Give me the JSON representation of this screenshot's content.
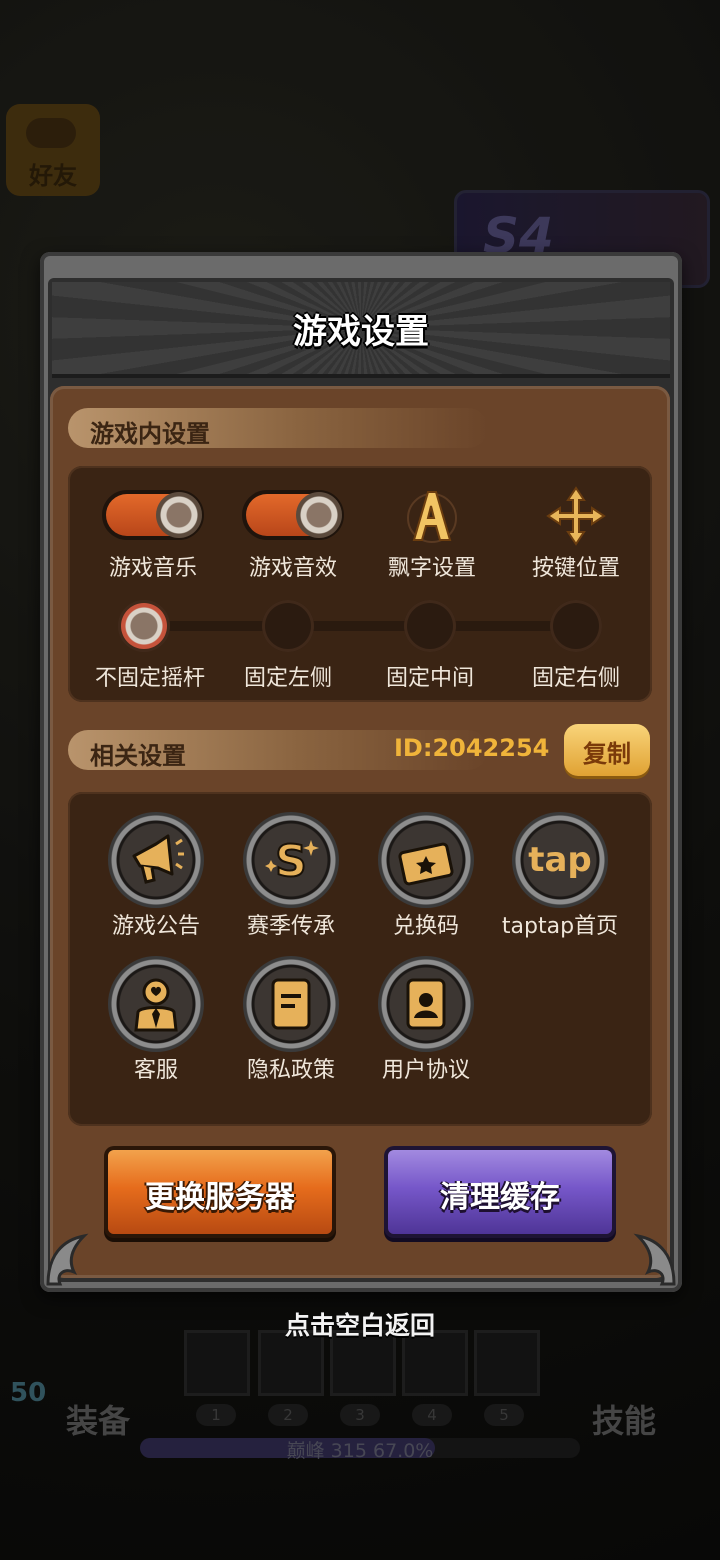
{
  "background": {
    "friend_button_label": "好友",
    "season_badge": "S4"
  },
  "dialog": {
    "title": "游戏设置",
    "in_game_section": {
      "title": "游戏内设置",
      "toggles": [
        {
          "label": "游戏音乐",
          "on": true
        },
        {
          "label": "游戏音效",
          "on": true
        }
      ],
      "buttons": [
        {
          "label": "飘字设置",
          "icon": "letter-a-icon"
        },
        {
          "label": "按键位置",
          "icon": "move-arrows-icon"
        }
      ],
      "joystick_options": [
        {
          "label": "不固定摇杆",
          "selected": true
        },
        {
          "label": "固定左侧",
          "selected": false
        },
        {
          "label": "固定中间",
          "selected": false
        },
        {
          "label": "固定右侧",
          "selected": false
        }
      ]
    },
    "related_section": {
      "title": "相关设置",
      "id_text": "ID:2042254",
      "copy_label": "复制",
      "items": [
        {
          "label": "游戏公告",
          "icon": "megaphone-icon"
        },
        {
          "label": "赛季传承",
          "icon": "season-s-icon"
        },
        {
          "label": "兑换码",
          "icon": "ticket-icon"
        },
        {
          "label": "taptap首页",
          "icon": "tap-logo-icon",
          "logo_text": "tap"
        },
        {
          "label": "客服",
          "icon": "customer-service-icon"
        },
        {
          "label": "隐私政策",
          "icon": "document-icon"
        },
        {
          "label": "用户协议",
          "icon": "user-card-icon"
        }
      ]
    },
    "change_server_label": "更换服务器",
    "clear_cache_label": "清理缓存"
  },
  "back_hint": "点击空白返回",
  "hud": {
    "level": "50",
    "equip_label": "装备",
    "skill_label": "技能",
    "slot_numbers": [
      "1",
      "2",
      "3",
      "4",
      "5"
    ],
    "xp_text": "巅峰 315  67.0%",
    "xp_progress": 0.67
  },
  "colors": {
    "panel_brown": "#6a4429",
    "toggle_on": "#e3692a",
    "id_gold": "#f0b43a",
    "server_button": "#e66c1c",
    "cache_button": "#7657c9"
  }
}
